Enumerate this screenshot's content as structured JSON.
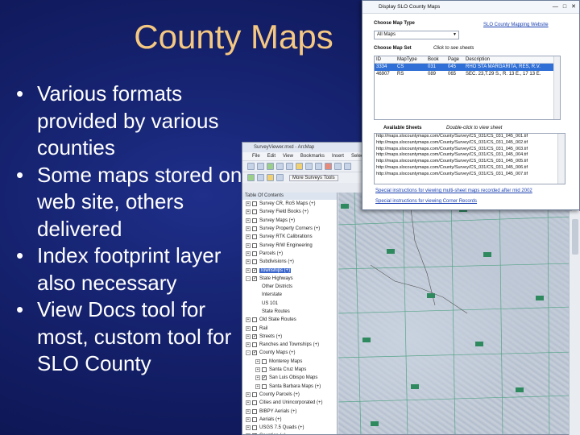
{
  "slide": {
    "title": "County Maps",
    "bullets": [
      "Various formats provided by various counties",
      "Some maps stored on web site, others delivered",
      "Index footprint layer also necessary",
      "View Docs tool for most, custom tool for SLO County"
    ],
    "bullet_glyph": "•"
  },
  "arcmap": {
    "title": "SurveyViewer.mxd - ArcMap",
    "menus": [
      "File",
      "Edit",
      "View",
      "Bookmarks",
      "Insert",
      "Selection"
    ],
    "more_tools_label": "More Surveys Tools",
    "toc_title": "Table Of Contents",
    "toc_rows": [
      {
        "label": "Survey CR, RoS Maps (+)",
        "expand": "+",
        "checked": false,
        "selected": false,
        "indent": 1
      },
      {
        "label": "Survey Field Books (+)",
        "expand": "+",
        "checked": false,
        "selected": false,
        "indent": 1
      },
      {
        "label": "Survey Maps (+)",
        "expand": "+",
        "checked": false,
        "selected": false,
        "indent": 1
      },
      {
        "label": "Survey Property Corners (+)",
        "expand": "+",
        "checked": false,
        "selected": false,
        "indent": 1
      },
      {
        "label": "Survey RTK Calibrations",
        "expand": "+",
        "checked": false,
        "selected": false,
        "indent": 1
      },
      {
        "label": "Survey R/W Engineering",
        "expand": "+",
        "checked": false,
        "selected": false,
        "indent": 1
      },
      {
        "label": "Parcels (+)",
        "expand": "+",
        "checked": false,
        "selected": false,
        "indent": 1
      },
      {
        "label": "Subdivisions (+)",
        "expand": "+",
        "checked": false,
        "selected": false,
        "indent": 1
      },
      {
        "label": "Townships (+)",
        "expand": "+",
        "checked": true,
        "selected": true,
        "indent": 1
      },
      {
        "label": "State Highways",
        "expand": "-",
        "checked": true,
        "selected": false,
        "indent": 1
      },
      {
        "label": "Other Districts",
        "expand": "",
        "checked": false,
        "selected": false,
        "indent": 2
      },
      {
        "label": "Interstate",
        "expand": "",
        "checked": false,
        "selected": false,
        "indent": 2
      },
      {
        "label": "US 101",
        "expand": "",
        "checked": false,
        "selected": false,
        "indent": 2
      },
      {
        "label": "State Routes",
        "expand": "",
        "checked": false,
        "selected": false,
        "indent": 2
      },
      {
        "label": "Old State Routes",
        "expand": "+",
        "checked": false,
        "selected": false,
        "indent": 1
      },
      {
        "label": "Rail",
        "expand": "+",
        "checked": false,
        "selected": false,
        "indent": 1
      },
      {
        "label": "Streets (+)",
        "expand": "+",
        "checked": true,
        "selected": false,
        "indent": 1
      },
      {
        "label": "Ranches and Townships (+)",
        "expand": "+",
        "checked": false,
        "selected": false,
        "indent": 1
      },
      {
        "label": "County Maps (+)",
        "expand": "-",
        "checked": true,
        "selected": false,
        "indent": 1
      },
      {
        "label": "Monterey Maps",
        "expand": "+",
        "checked": false,
        "selected": false,
        "indent": 2
      },
      {
        "label": "Santa Cruz Maps",
        "expand": "+",
        "checked": false,
        "selected": false,
        "indent": 2
      },
      {
        "label": "San Luis Obispo Maps",
        "expand": "+",
        "checked": true,
        "selected": false,
        "indent": 2
      },
      {
        "label": "Santa Barbara Maps (+)",
        "expand": "+",
        "checked": false,
        "selected": false,
        "indent": 2
      },
      {
        "label": "County Parcels (+)",
        "expand": "+",
        "checked": false,
        "selected": false,
        "indent": 1
      },
      {
        "label": "Cities and Unincorporated (+)",
        "expand": "+",
        "checked": false,
        "selected": false,
        "indent": 1
      },
      {
        "label": "BIBPY Aerials (+)",
        "expand": "+",
        "checked": false,
        "selected": false,
        "indent": 1
      },
      {
        "label": "Aerials (+)",
        "expand": "+",
        "checked": false,
        "selected": false,
        "indent": 1
      },
      {
        "label": "USGS 7.5 Quads (+)",
        "expand": "+",
        "checked": false,
        "selected": false,
        "indent": 1
      },
      {
        "label": "Counties (+)",
        "expand": "+",
        "checked": true,
        "selected": false,
        "indent": 1
      }
    ]
  },
  "dialog": {
    "title": "Display SLO County Maps",
    "controls": {
      "minimize": "—",
      "maximize": "□",
      "close": "✕"
    },
    "map_type_label": "Choose Map Type",
    "map_type_value": "All Maps",
    "website_link": "SLO County Mapping Website",
    "map_set_label": "Choose Map Set",
    "map_set_hint": "Click to see sheets",
    "grid_headers": [
      "ID",
      "MapType",
      "Book",
      "Page",
      "Description"
    ],
    "grid_rows": [
      {
        "cells": [
          "3334",
          "CS",
          "031",
          "045",
          "RHO STA MARGARITA, RES, R.V."
        ],
        "selected": true
      },
      {
        "cells": [
          "46907",
          "RS",
          "089",
          "065",
          "SEC. 23,T.29 S., R. 13 E., 17 13 E."
        ],
        "selected": false
      }
    ],
    "sheets_label": "Available Sheets",
    "sheets_hint": "Double-click to view sheet",
    "sheet_rows": [
      "http://maps.slocountymaps.com/County/Survey/CS_031/CS_031_045_001.tif",
      "http://maps.slocountymaps.com/County/Survey/CS_031/CS_031_045_002.tif",
      "http://maps.slocountymaps.com/County/Survey/CS_031/CS_031_045_003.tif",
      "http://maps.slocountymaps.com/County/Survey/CS_031/CS_031_045_004.tif",
      "http://maps.slocountymaps.com/County/Survey/CS_031/CS_031_045_005.tif",
      "http://maps.slocountymaps.com/County/Survey/CS_031/CS_031_045_006.tif",
      "http://maps.slocountymaps.com/County/Survey/CS_031/CS_031_045_007.tif"
    ],
    "special_link_1": "Special instructions for viewing multi-sheet maps recorded after mid 2002",
    "special_link_2": "Special instructions for viewing Corner Records"
  },
  "colors": {
    "title": "#f5c882",
    "bullet_text": "#ffffff",
    "background": "#14206a",
    "selection": "#2f6fd6",
    "link": "#1a3fb0"
  }
}
